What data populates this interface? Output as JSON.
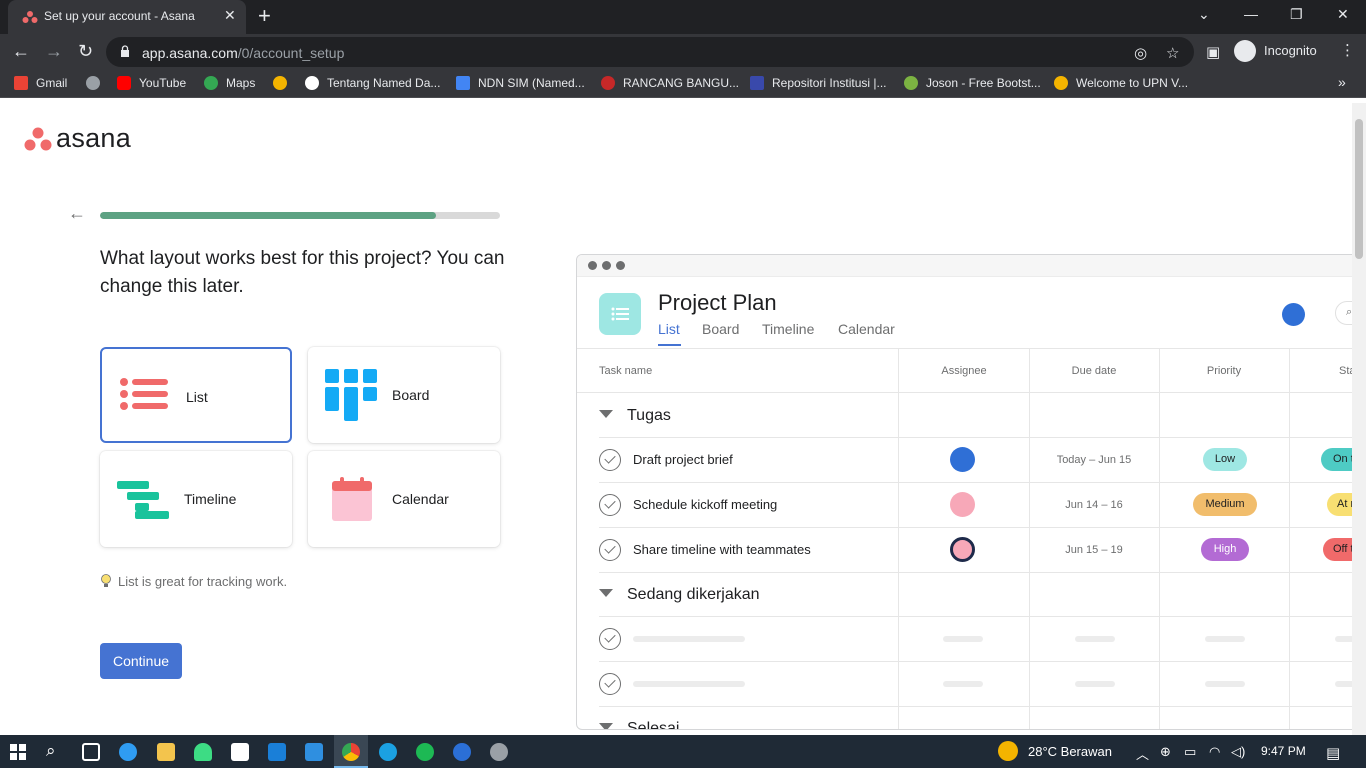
{
  "browser": {
    "tab_title": "Set up your account - Asana",
    "url_host": "app.asana.com",
    "url_path": "/0/account_setup",
    "incognito_label": "Incognito",
    "bookmarks": [
      {
        "label": "Gmail",
        "color": "#ea4335"
      },
      {
        "label": "",
        "color": "#9aa0a6"
      },
      {
        "label": "YouTube",
        "color": "#ff0000"
      },
      {
        "label": "Maps",
        "color": "#34a853"
      },
      {
        "label": "",
        "color": "#f4b400"
      },
      {
        "label": "Tentang Named Da...",
        "color": "#ffffff"
      },
      {
        "label": "NDN SIM (Named...",
        "color": "#4285f4"
      },
      {
        "label": "RANCANG BANGU...",
        "color": "#c62828"
      },
      {
        "label": "Repositori Institusi |...",
        "color": "#3949ab"
      },
      {
        "label": "Joson - Free Bootst...",
        "color": "#7cb342"
      },
      {
        "label": "Welcome to UPN V...",
        "color": "#f4b400"
      }
    ]
  },
  "app": {
    "logo_text": "asana",
    "progress": 0.84,
    "question": "What layout works best for this project? You can change this later.",
    "layouts": [
      {
        "label": "List",
        "selected": true
      },
      {
        "label": "Board",
        "selected": false
      },
      {
        "label": "Timeline",
        "selected": false
      },
      {
        "label": "Calendar",
        "selected": false
      }
    ],
    "tip": "List is great for tracking work.",
    "continue_label": "Continue"
  },
  "preview": {
    "project_title": "Project Plan",
    "tabs": [
      "List",
      "Board",
      "Timeline",
      "Calendar"
    ],
    "columns": [
      "Task name",
      "Assignee",
      "Due date",
      "Priority",
      "Status"
    ],
    "sections": [
      {
        "name": "Tugas",
        "tasks": [
          {
            "name": "Draft project brief",
            "due": "Today – Jun 15",
            "priority": "Low",
            "status": "On track"
          },
          {
            "name": "Schedule kickoff meeting",
            "due": "Jun 14 – 16",
            "priority": "Medium",
            "status": "At risk"
          },
          {
            "name": "Share timeline with teammates",
            "due": "Jun 15 – 19",
            "priority": "High",
            "status": "Off track"
          }
        ]
      },
      {
        "name": "Sedang dikerjakan"
      },
      {
        "name": "Selesai"
      }
    ],
    "colors": {
      "low": "#9ee7e3",
      "medium": "#f1bd6c",
      "high": "#b36bd4",
      "on_track": "#4ecbc4",
      "at_risk": "#f8df72",
      "off_track": "#f06a6a"
    }
  },
  "taskbar": {
    "weather": "28°C  Berawan",
    "time": "9:47 PM"
  }
}
